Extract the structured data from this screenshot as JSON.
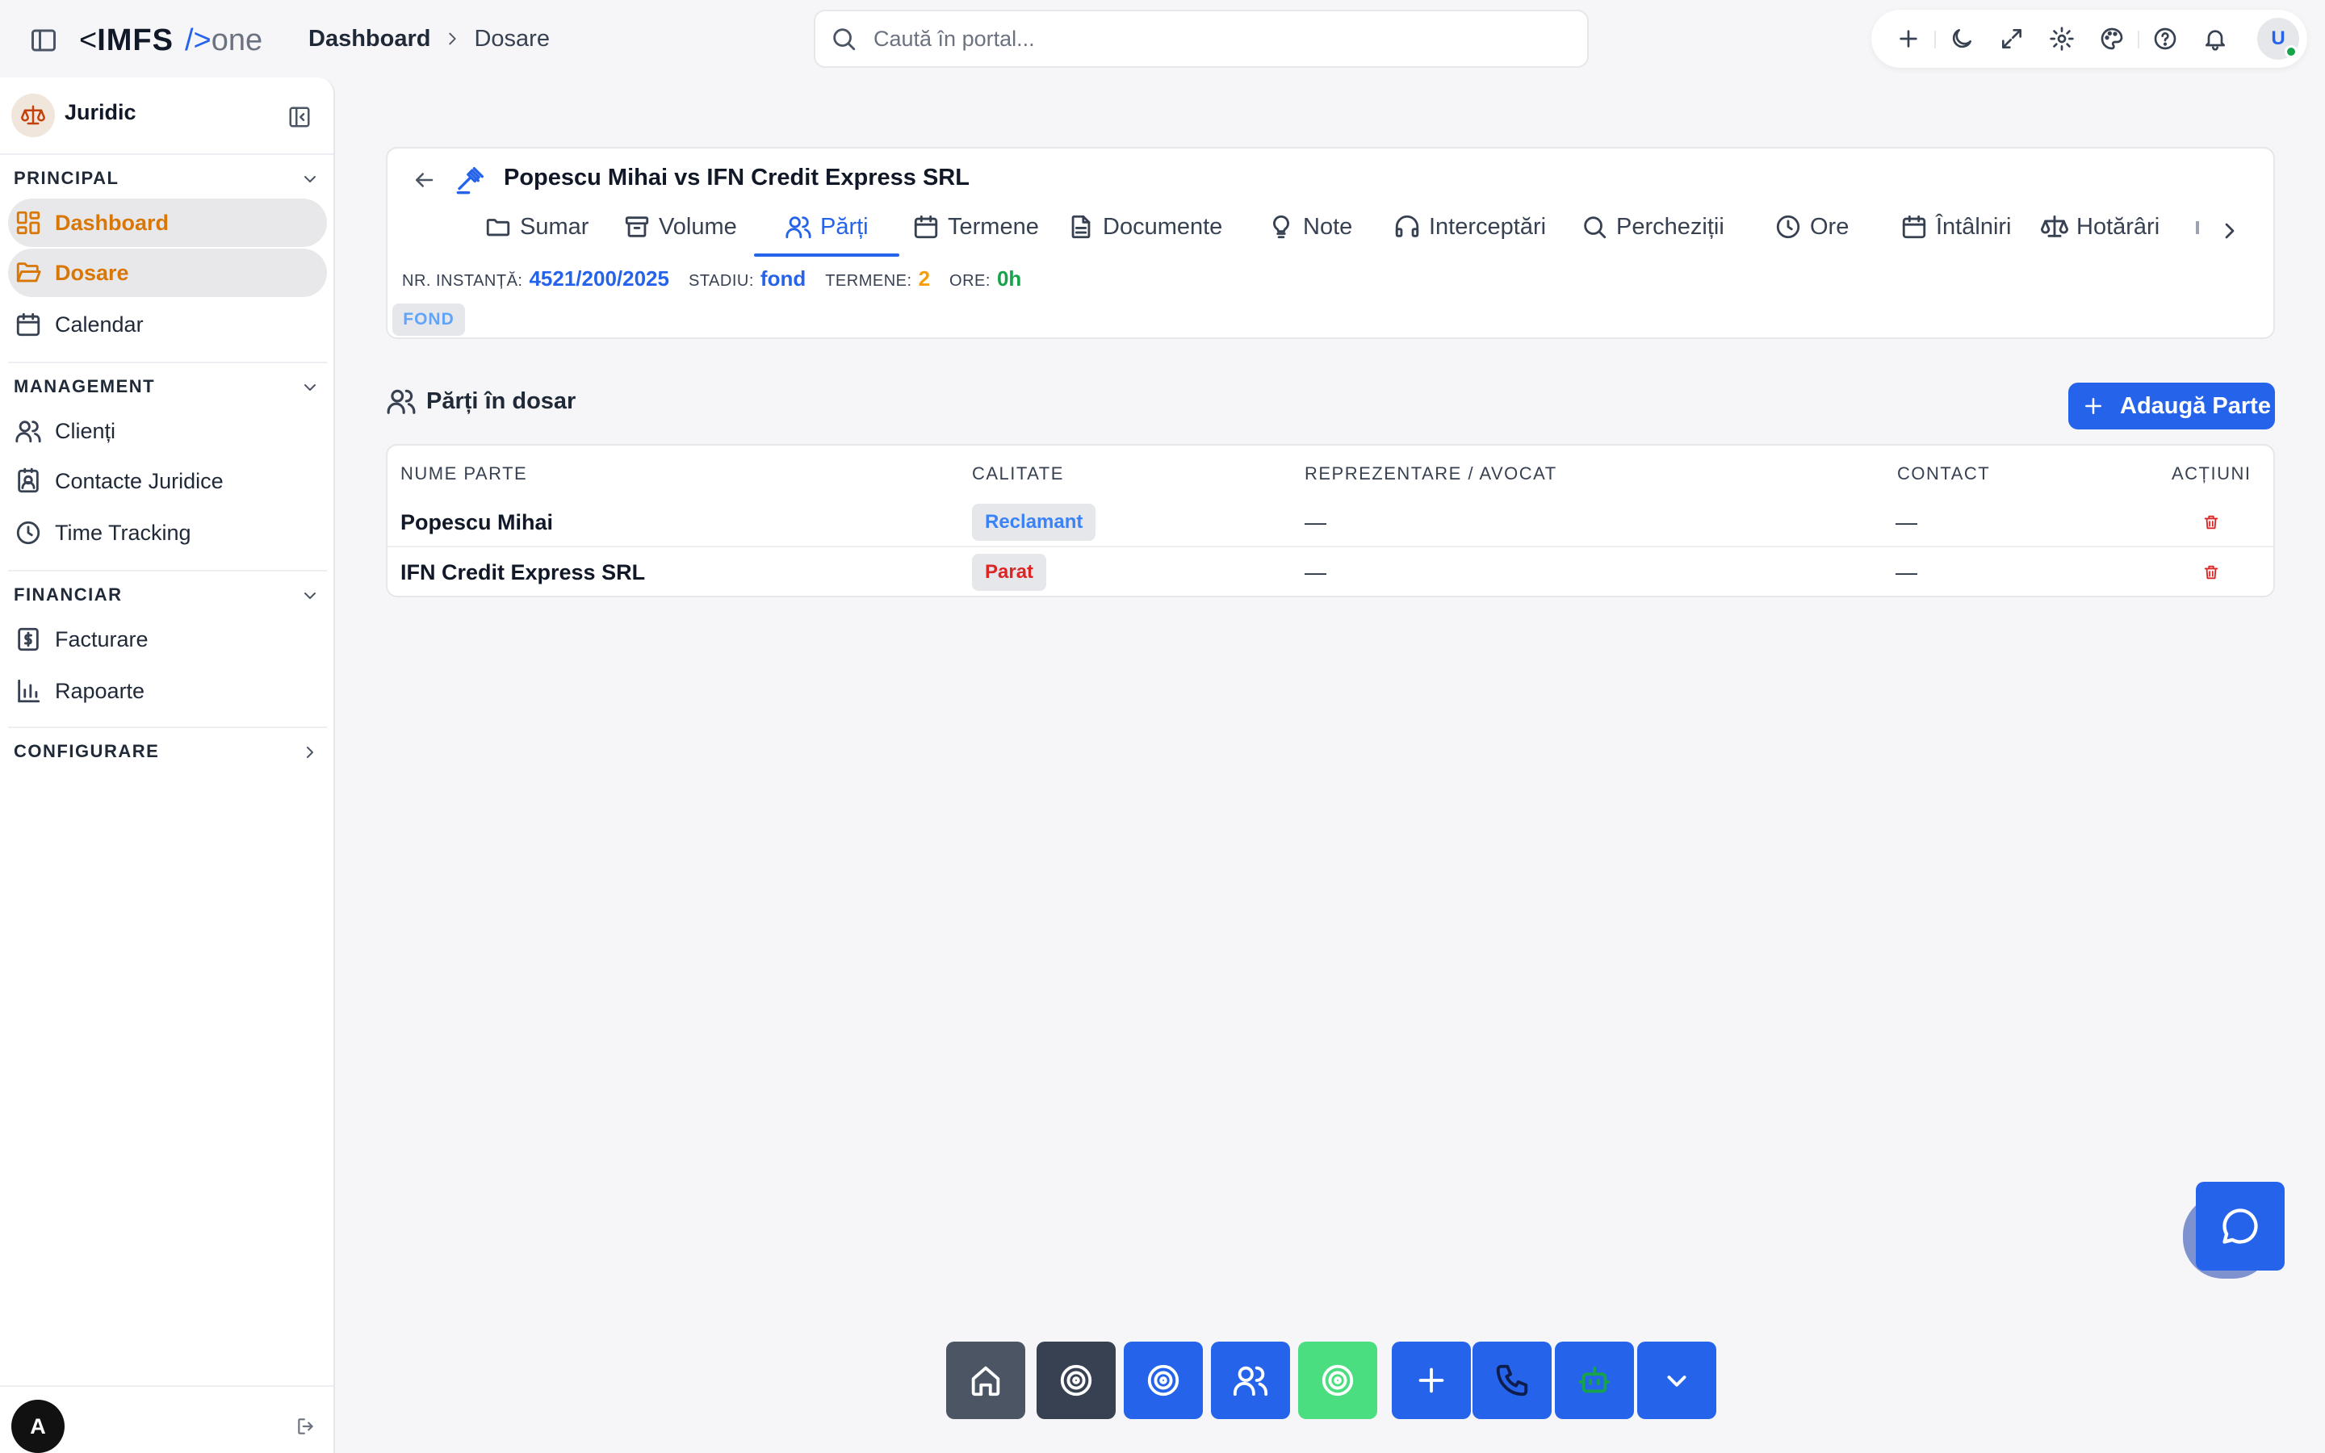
{
  "app": {
    "logo_lt": "<",
    "logo_main": "IMFS",
    "logo_slash": "/>",
    "logo_suffix": "one"
  },
  "breadcrumb": {
    "items": [
      "Dashboard",
      "Dosare"
    ]
  },
  "search": {
    "placeholder": "Caută în portal..."
  },
  "topbar": {
    "icons": [
      "plus-icon",
      "moon-icon",
      "expand-icon",
      "gear-icon",
      "palette-icon",
      "help-icon",
      "bell-icon"
    ],
    "avatar_initial": "U",
    "status_color": "#16a34a"
  },
  "sidebar": {
    "title": "Juridic",
    "sections": [
      {
        "title": "PRINCIPAL",
        "expanded": true,
        "items": [
          {
            "label": "Dashboard",
            "icon": "dashboard-icon",
            "active": true
          },
          {
            "label": "Dosare",
            "icon": "folder-open-icon",
            "active": true
          },
          {
            "label": "Calendar",
            "icon": "calendar-icon",
            "active": false
          }
        ]
      },
      {
        "title": "MANAGEMENT",
        "expanded": true,
        "items": [
          {
            "label": "Clienți",
            "icon": "users-icon",
            "active": false
          },
          {
            "label": "Contacte Juridice",
            "icon": "contact-icon",
            "active": false
          },
          {
            "label": "Time Tracking",
            "icon": "clock-icon",
            "active": false
          }
        ]
      },
      {
        "title": "FINANCIAR",
        "expanded": true,
        "items": [
          {
            "label": "Facturare",
            "icon": "invoice-icon",
            "active": false
          },
          {
            "label": "Rapoarte",
            "icon": "bar-chart-icon",
            "active": false
          }
        ]
      },
      {
        "title": "CONFIGURARE",
        "expanded": false,
        "items": []
      }
    ],
    "footer_avatar": "A",
    "active_color": "#d97706"
  },
  "case": {
    "title": "Popescu Mihai vs IFN Credit Express SRL",
    "tabs": [
      {
        "label": "Sumar",
        "icon": "folder-icon"
      },
      {
        "label": "Volume",
        "icon": "archive-icon"
      },
      {
        "label": "Părți",
        "icon": "users-icon",
        "active": true
      },
      {
        "label": "Termene",
        "icon": "calendar-icon"
      },
      {
        "label": "Documente",
        "icon": "document-icon"
      },
      {
        "label": "Note",
        "icon": "lightbulb-icon"
      },
      {
        "label": "Interceptări",
        "icon": "headphones-icon"
      },
      {
        "label": "Percheziții",
        "icon": "search-icon"
      },
      {
        "label": "Ore",
        "icon": "clock-icon"
      },
      {
        "label": "Întâlniri",
        "icon": "calendar-icon"
      },
      {
        "label": "Hotărâri",
        "icon": "scale-icon"
      }
    ],
    "meta": {
      "instance_label": "NR. INSTANȚĂ:",
      "instance_value": "4521/200/2025",
      "stage_label": "STADIU:",
      "stage_value": "fond",
      "terms_label": "TERMENE:",
      "terms_value": "2",
      "hours_label": "ORE:",
      "hours_value": "0h"
    },
    "stage_badge": "FOND"
  },
  "parties": {
    "title": "Părți în dosar",
    "add_label": "Adaugă Parte",
    "columns": [
      "NUME PARTE",
      "CALITATE",
      "REPREZENTARE / AVOCAT",
      "CONTACT",
      "ACȚIUNI"
    ],
    "rows": [
      {
        "name": "Popescu Mihai",
        "role": "Reclamant",
        "role_color": "#3b82f6",
        "representation": "—",
        "contact": "—"
      },
      {
        "name": "IFN Credit Express SRL",
        "role": "Parat",
        "role_color": "#dc2626",
        "representation": "—",
        "contact": "—"
      }
    ]
  },
  "dock": {
    "buttons": [
      {
        "icon": "home-icon",
        "color": "#4b5563"
      },
      {
        "icon": "target-icon",
        "color": "#374151"
      },
      {
        "icon": "target-icon",
        "color": "#2563eb"
      },
      {
        "icon": "users-icon",
        "color": "#2563eb"
      },
      {
        "icon": "target-icon",
        "color": "#4ade80"
      },
      {
        "icon": "plus-icon",
        "color": "#2563eb"
      },
      {
        "icon": "phone-icon",
        "color": "#2563eb"
      },
      {
        "icon": "bot-icon",
        "color": "#2563eb"
      },
      {
        "icon": "chevron-down-icon",
        "color": "#2563eb"
      }
    ]
  },
  "chat": {
    "icon": "chat-icon",
    "color": "#2563eb"
  }
}
